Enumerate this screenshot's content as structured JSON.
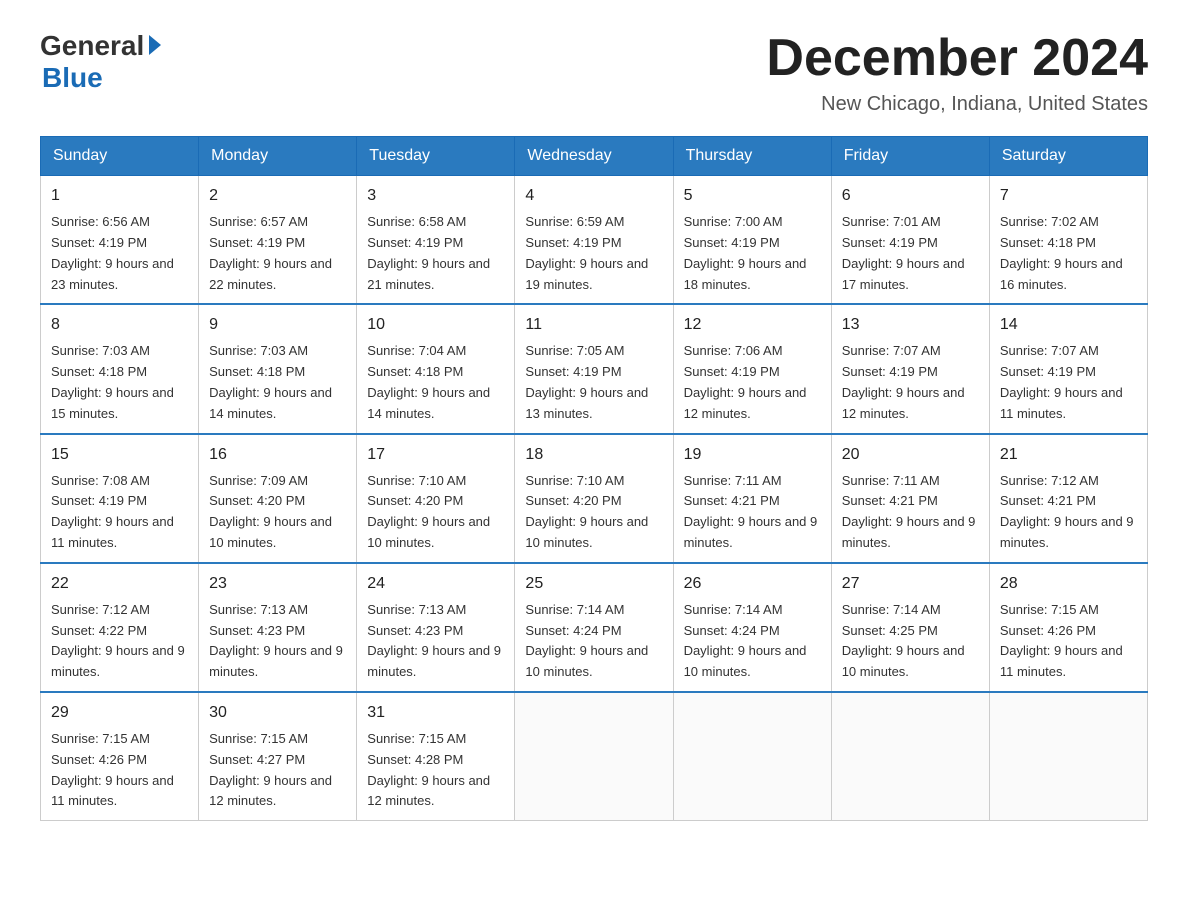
{
  "header": {
    "logo": {
      "general": "General",
      "blue": "Blue"
    },
    "title": "December 2024",
    "location": "New Chicago, Indiana, United States"
  },
  "days_of_week": [
    "Sunday",
    "Monday",
    "Tuesday",
    "Wednesday",
    "Thursday",
    "Friday",
    "Saturday"
  ],
  "weeks": [
    [
      {
        "day": "1",
        "sunrise": "6:56 AM",
        "sunset": "4:19 PM",
        "daylight": "9 hours and 23 minutes."
      },
      {
        "day": "2",
        "sunrise": "6:57 AM",
        "sunset": "4:19 PM",
        "daylight": "9 hours and 22 minutes."
      },
      {
        "day": "3",
        "sunrise": "6:58 AM",
        "sunset": "4:19 PM",
        "daylight": "9 hours and 21 minutes."
      },
      {
        "day": "4",
        "sunrise": "6:59 AM",
        "sunset": "4:19 PM",
        "daylight": "9 hours and 19 minutes."
      },
      {
        "day": "5",
        "sunrise": "7:00 AM",
        "sunset": "4:19 PM",
        "daylight": "9 hours and 18 minutes."
      },
      {
        "day": "6",
        "sunrise": "7:01 AM",
        "sunset": "4:19 PM",
        "daylight": "9 hours and 17 minutes."
      },
      {
        "day": "7",
        "sunrise": "7:02 AM",
        "sunset": "4:18 PM",
        "daylight": "9 hours and 16 minutes."
      }
    ],
    [
      {
        "day": "8",
        "sunrise": "7:03 AM",
        "sunset": "4:18 PM",
        "daylight": "9 hours and 15 minutes."
      },
      {
        "day": "9",
        "sunrise": "7:03 AM",
        "sunset": "4:18 PM",
        "daylight": "9 hours and 14 minutes."
      },
      {
        "day": "10",
        "sunrise": "7:04 AM",
        "sunset": "4:18 PM",
        "daylight": "9 hours and 14 minutes."
      },
      {
        "day": "11",
        "sunrise": "7:05 AM",
        "sunset": "4:19 PM",
        "daylight": "9 hours and 13 minutes."
      },
      {
        "day": "12",
        "sunrise": "7:06 AM",
        "sunset": "4:19 PM",
        "daylight": "9 hours and 12 minutes."
      },
      {
        "day": "13",
        "sunrise": "7:07 AM",
        "sunset": "4:19 PM",
        "daylight": "9 hours and 12 minutes."
      },
      {
        "day": "14",
        "sunrise": "7:07 AM",
        "sunset": "4:19 PM",
        "daylight": "9 hours and 11 minutes."
      }
    ],
    [
      {
        "day": "15",
        "sunrise": "7:08 AM",
        "sunset": "4:19 PM",
        "daylight": "9 hours and 11 minutes."
      },
      {
        "day": "16",
        "sunrise": "7:09 AM",
        "sunset": "4:20 PM",
        "daylight": "9 hours and 10 minutes."
      },
      {
        "day": "17",
        "sunrise": "7:10 AM",
        "sunset": "4:20 PM",
        "daylight": "9 hours and 10 minutes."
      },
      {
        "day": "18",
        "sunrise": "7:10 AM",
        "sunset": "4:20 PM",
        "daylight": "9 hours and 10 minutes."
      },
      {
        "day": "19",
        "sunrise": "7:11 AM",
        "sunset": "4:21 PM",
        "daylight": "9 hours and 9 minutes."
      },
      {
        "day": "20",
        "sunrise": "7:11 AM",
        "sunset": "4:21 PM",
        "daylight": "9 hours and 9 minutes."
      },
      {
        "day": "21",
        "sunrise": "7:12 AM",
        "sunset": "4:21 PM",
        "daylight": "9 hours and 9 minutes."
      }
    ],
    [
      {
        "day": "22",
        "sunrise": "7:12 AM",
        "sunset": "4:22 PM",
        "daylight": "9 hours and 9 minutes."
      },
      {
        "day": "23",
        "sunrise": "7:13 AM",
        "sunset": "4:23 PM",
        "daylight": "9 hours and 9 minutes."
      },
      {
        "day": "24",
        "sunrise": "7:13 AM",
        "sunset": "4:23 PM",
        "daylight": "9 hours and 9 minutes."
      },
      {
        "day": "25",
        "sunrise": "7:14 AM",
        "sunset": "4:24 PM",
        "daylight": "9 hours and 10 minutes."
      },
      {
        "day": "26",
        "sunrise": "7:14 AM",
        "sunset": "4:24 PM",
        "daylight": "9 hours and 10 minutes."
      },
      {
        "day": "27",
        "sunrise": "7:14 AM",
        "sunset": "4:25 PM",
        "daylight": "9 hours and 10 minutes."
      },
      {
        "day": "28",
        "sunrise": "7:15 AM",
        "sunset": "4:26 PM",
        "daylight": "9 hours and 11 minutes."
      }
    ],
    [
      {
        "day": "29",
        "sunrise": "7:15 AM",
        "sunset": "4:26 PM",
        "daylight": "9 hours and 11 minutes."
      },
      {
        "day": "30",
        "sunrise": "7:15 AM",
        "sunset": "4:27 PM",
        "daylight": "9 hours and 12 minutes."
      },
      {
        "day": "31",
        "sunrise": "7:15 AM",
        "sunset": "4:28 PM",
        "daylight": "9 hours and 12 minutes."
      },
      null,
      null,
      null,
      null
    ]
  ]
}
